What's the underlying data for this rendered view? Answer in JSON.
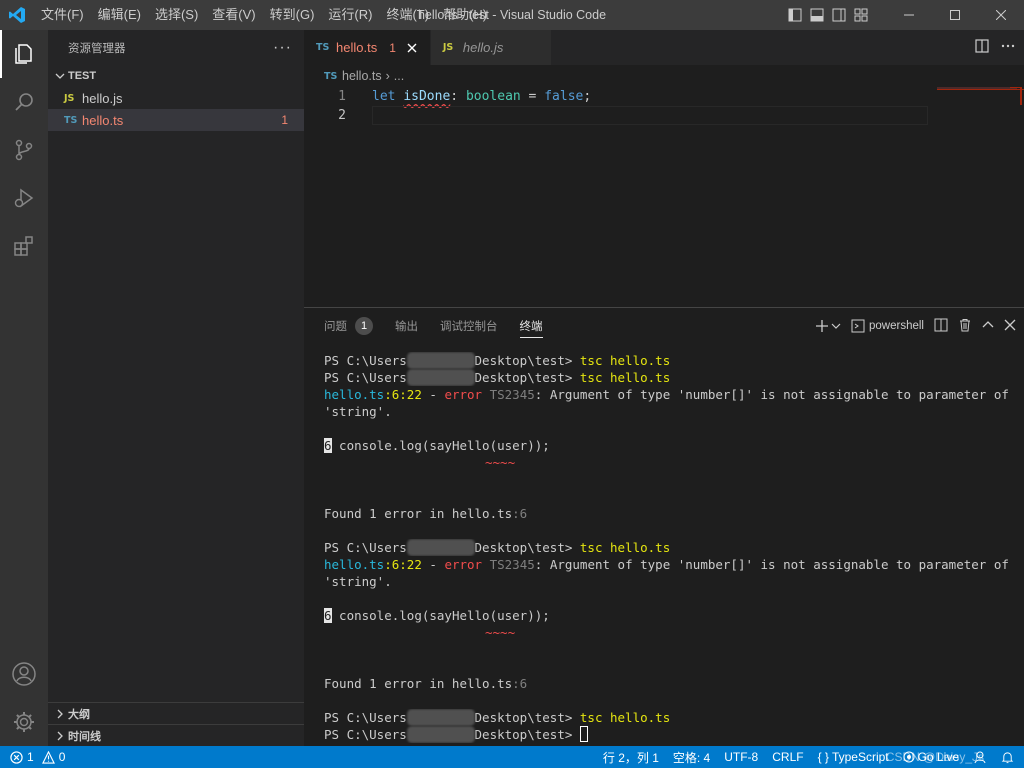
{
  "titlebar": {
    "menu": [
      "文件(F)",
      "编辑(E)",
      "选择(S)",
      "查看(V)",
      "转到(G)",
      "运行(R)",
      "终端(T)",
      "帮助(H)"
    ],
    "window_title": "hello.ts - test - Visual Studio Code"
  },
  "sidebar": {
    "title": "资源管理器",
    "more": "···",
    "folder": "TEST",
    "files": [
      {
        "icon": "JS",
        "name": "hello.js"
      },
      {
        "icon": "TS",
        "name": "hello.ts",
        "badge": "1"
      }
    ],
    "outline": "大纲",
    "timeline": "时间线"
  },
  "tabs": [
    {
      "icon": "TS",
      "name": "hello.ts",
      "badge": "1"
    },
    {
      "icon": "JS",
      "name": "hello.js"
    }
  ],
  "breadcrumb": {
    "icon": "TS",
    "file": "hello.ts",
    "sep": "›",
    "rest": "..."
  },
  "editor": {
    "line_numbers": [
      "1",
      "2"
    ],
    "line1": {
      "kw": "let",
      "var": "isDone",
      "colon": ": ",
      "type": "boolean",
      "eq": " = ",
      "value": "false",
      "end": ";"
    }
  },
  "panel": {
    "tabs": [
      "问题",
      "输出",
      "调试控制台",
      "终端"
    ],
    "problems_count": "1",
    "active_tab": "终端",
    "shell": "powershell",
    "plus": "+"
  },
  "terminal": {
    "ps_prefix": "PS C:\\Users",
    "ps_suffix": "Desktop\\test>",
    "cmd": "tsc hello.ts",
    "err_file": "hello.ts",
    "err_pos": ":6:22",
    "err_dash": " - ",
    "err_word": "error",
    "err_code": " TS2345",
    "err_msg": ": Argument of type 'number[]' is not assignable to parameter of type",
    "err_msg2": "'string'.",
    "code_lineno": "6",
    "code_text": " console.log(sayHello(user));",
    "squiggle": "~~~~",
    "found_text": "Found 1 error in hello.ts",
    "found_pos": ":6"
  },
  "statusbar": {
    "errors": "1",
    "warnings": "0",
    "position": "行 2，列 1",
    "spaces": "空格: 4",
    "encoding": "UTF-8",
    "eol": "CRLF",
    "language": "TypeScript",
    "golive": "Go Live",
    "watermark": "CSDN @Daisy_Js"
  }
}
